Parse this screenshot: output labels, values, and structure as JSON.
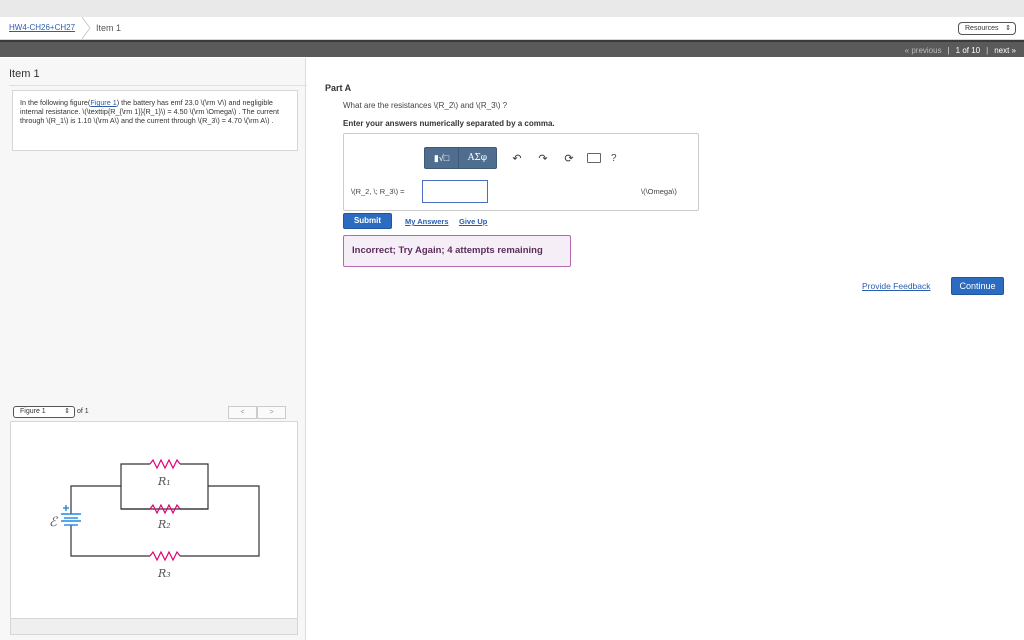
{
  "breadcrumb": {
    "assignment": "HW4-CH26+CH27",
    "current": "Item 1"
  },
  "header": {
    "resources_label": "Resources"
  },
  "pager": {
    "previous": "« previous",
    "position": "1 of 10",
    "next": "next »"
  },
  "item": {
    "title": "Item 1"
  },
  "problem": {
    "text_before_link": "In the following figure(",
    "figure_link": "Figure 1",
    "text_after_link": ") the battery has emf 23.0 \\(\\rm V\\) and negligible internal resistance. \\(\\texttip{R_{\\rm 1}}{R_1}\\) = 4.50 \\(\\rm \\Omega\\) . The current through \\(R_1\\) is 1.10 \\(\\rm A\\) and the current through \\(R_3\\) = 4.70 \\(\\rm A\\) ."
  },
  "figure": {
    "selector": "Figure 1",
    "of_label": "of 1",
    "prev": "<",
    "next": ">",
    "labels": {
      "emf": "ℰ",
      "r1": "R₁",
      "r2": "R₂",
      "r3": "R₃"
    }
  },
  "part": {
    "title": "Part A",
    "question": "What are the resistances \\(R_2\\) and \\(R_3\\) ?",
    "instruction": "Enter your answers numerically separated by a comma.",
    "toolbar": {
      "template": "▮√□",
      "greek": "ΑΣφ",
      "help": "?"
    },
    "answer_label": "\\(R_2, \\; R_3\\) =",
    "answer_value": "",
    "unit": "\\(\\Omega\\)",
    "submit": "Submit",
    "my_answers": "My Answers",
    "give_up": "Give Up",
    "feedback": "Incorrect; Try Again; 4 attempts remaining"
  },
  "footer": {
    "provide_feedback": "Provide Feedback",
    "continue": "Continue"
  },
  "colors": {
    "accent": "#2b6cc1",
    "resistor": "#e0007a",
    "battery": "#1e88e5",
    "feedback_border": "#b46bb4"
  }
}
